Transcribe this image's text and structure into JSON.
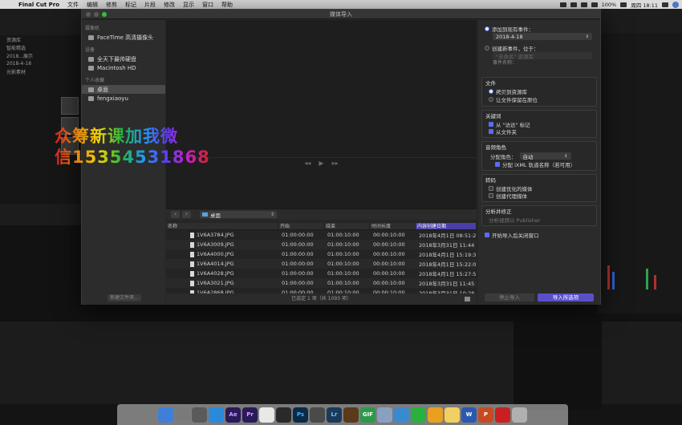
{
  "menubar": {
    "app_name": "Final Cut Pro",
    "items": [
      "文件",
      "编辑",
      "修剪",
      "标记",
      "片段",
      "修改",
      "显示",
      "窗口",
      "帮助"
    ],
    "battery": "100%",
    "clock": "周四 18:11"
  },
  "background_app": {
    "libraries": [
      "资源库",
      "智能精选",
      "2018...展示",
      "2018-4-18",
      "光影素材"
    ]
  },
  "dialog": {
    "title": "媒体导入",
    "sidebar": {
      "cameras_header": "摄像机",
      "cameras": [
        "FaceTime 高清摄像头"
      ],
      "devices_header": "设备",
      "devices": [
        "全天下最帅硬盘",
        "Macintosh HD"
      ],
      "favorites_header": "个人收藏",
      "favorites": [
        "桌面",
        "fengxiaoyu"
      ],
      "new_folder_label": "新建文件夹..."
    },
    "watermark": {
      "line1": "众筹新课加我微",
      "line2": "信15354531868"
    },
    "browser": {
      "path": "桌面",
      "columns": [
        "名称",
        "开始",
        "结束",
        "时间长度",
        "内容创建日期"
      ],
      "rows": [
        {
          "name": "1V6A3784.JPG",
          "start": "01:00:00:00",
          "end": "01:00:10:00",
          "duration": "00:00:10:00",
          "date": "2018年4月1日 08:51:2"
        },
        {
          "name": "1V6A3009.JPG",
          "start": "01:00:00:00",
          "end": "01:00:10:00",
          "duration": "00:00:10:00",
          "date": "2018年3月31日 11:44"
        },
        {
          "name": "1V6A4000.JPG",
          "start": "01:00:00:00",
          "end": "01:00:10:00",
          "duration": "00:00:10:00",
          "date": "2018年4月1日 15:19:3"
        },
        {
          "name": "1V6A4014.JPG",
          "start": "01:00:00:00",
          "end": "01:00:10:00",
          "duration": "00:00:10:00",
          "date": "2018年4月1日 15:22:0"
        },
        {
          "name": "1V6A4028.JPG",
          "start": "01:00:00:00",
          "end": "01:00:10:00",
          "duration": "00:00:10:00",
          "date": "2018年4月1日 15:27:5"
        },
        {
          "name": "1V6A3021.JPG",
          "start": "01:00:00:00",
          "end": "01:00:10:00",
          "duration": "00:00:10:00",
          "date": "2018年3月31日 11:45"
        },
        {
          "name": "1V6A2868.JPG",
          "start": "01:00:00:00",
          "end": "01:00:10:00",
          "duration": "00:00:10:00",
          "date": "2018年3月31日 10:28"
        }
      ],
      "status": "已选定 1 项（共 1093 项）"
    },
    "panel": {
      "add_existing_event": "添加到现有事件：",
      "existing_event_value": "2018-4-18",
      "create_new_event": "创建新事件，位于：",
      "library_value": "\"未命名\" 资源库",
      "event_name_label": "事件名称：",
      "files_title": "文件",
      "copy_to_library": "拷贝到资源库",
      "leave_in_place": "让文件保留在原位",
      "keywords_title": "关键词",
      "from_finder_tags": "从 \"访达\" 标记",
      "from_folders": "从文件夹",
      "audio_roles_title": "音频角色",
      "assign_role_label": "分配角色：",
      "assign_role_value": "自动",
      "assign_ixml": "分配 iXML 轨道名称（若可用）",
      "transcode_title": "转码",
      "create_optimized": "创建优化的媒体",
      "create_proxy": "创建代理媒体",
      "analyze_title": "分析并修正",
      "analyze_sub": "分析视频以 Publisher",
      "close_after_import": "开始导入后关闭窗口",
      "stop_import": "停止导入",
      "import_selected": "导入所选项"
    }
  },
  "dock": {
    "apps": [
      "Finder",
      "Launchpad",
      "Siri",
      "Safari",
      "Ae",
      "Pr",
      "Photos",
      "DaVinci",
      "Ps",
      "Final Cut",
      "Lr",
      "Motion",
      "GIF",
      "Preview",
      "Mail",
      "WeChat",
      "QQ",
      "Notes",
      "Word",
      "PowerPoint",
      "NetEase",
      "Trash"
    ]
  }
}
